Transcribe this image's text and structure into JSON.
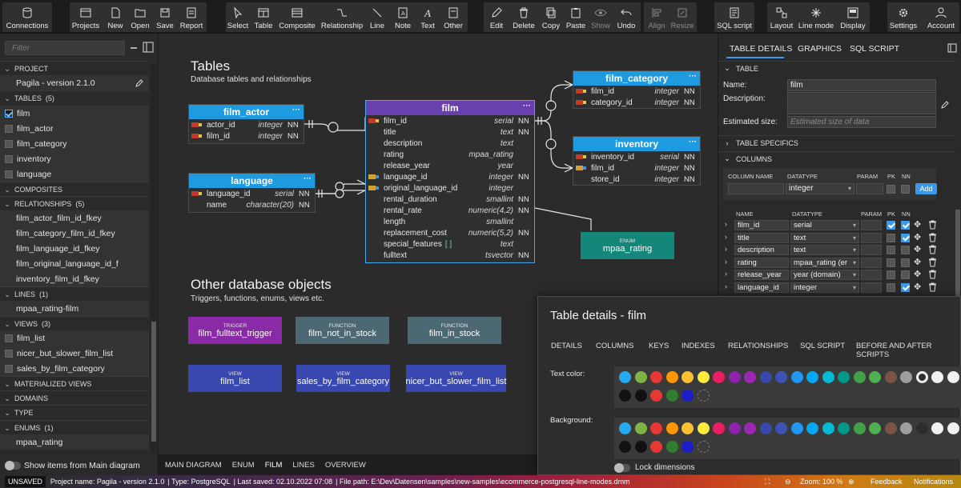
{
  "toolbar": {
    "connections": "Connections",
    "projects": "Projects",
    "new": "New",
    "open": "Open",
    "save": "Save",
    "report": "Report",
    "select": "Select",
    "table": "Table",
    "composite": "Composite",
    "relationship": "Relationship",
    "line": "Line",
    "note": "Note",
    "text": "Text",
    "other": "Other",
    "edit": "Edit",
    "delete": "Delete",
    "copy": "Copy",
    "paste": "Paste",
    "show": "Show",
    "undo": "Undo",
    "align": "Align",
    "resize": "Resize",
    "sql_script": "SQL script",
    "layout": "Layout",
    "line_mode": "Line mode",
    "display": "Display",
    "settings": "Settings",
    "account": "Account"
  },
  "left": {
    "filter_placeholder": "Filter",
    "project_header": "PROJECT",
    "project_name": "Pagila - version 2.1.0",
    "tables_header": "TABLES",
    "tables_count": "(5)",
    "tables": [
      "film",
      "film_actor",
      "film_category",
      "inventory",
      "language"
    ],
    "composites_header": "COMPOSITES",
    "relationships_header": "RELATIONSHIPS",
    "relationships_count": "(5)",
    "relationships": [
      "film_actor_film_id_fkey",
      "film_category_film_id_fkey",
      "film_language_id_fkey",
      "film_original_language_id_f",
      "inventory_film_id_fkey"
    ],
    "lines_header": "LINES",
    "lines_count": "(1)",
    "lines": [
      "mpaa_rating-film"
    ],
    "views_header": "VIEWS",
    "views_count": "(3)",
    "views": [
      "film_list",
      "nicer_but_slower_film_list",
      "sales_by_film_category"
    ],
    "mat_views_header": "MATERIALIZED VIEWS",
    "domains_header": "DOMAINS",
    "type_header": "TYPE",
    "enums_header": "ENUMS",
    "enums_count": "(1)",
    "enums": [
      "mpaa_rating"
    ],
    "show_items": "Show items from Main diagram"
  },
  "canvas": {
    "title": "Tables",
    "subtitle": "Database tables and relationships",
    "other_title": "Other database objects",
    "other_subtitle": "Triggers, functions, enums, views etc.",
    "film": {
      "name": "film",
      "cols": [
        [
          "pk",
          "film_id",
          "serial",
          "NN"
        ],
        [
          "",
          "title",
          "text",
          "NN"
        ],
        [
          "",
          "description",
          "text",
          ""
        ],
        [
          "",
          "rating",
          "mpaa_rating",
          ""
        ],
        [
          "",
          "release_year",
          "year",
          ""
        ],
        [
          "fk",
          "language_id",
          "integer",
          "NN"
        ],
        [
          "fk",
          "original_language_id",
          "integer",
          ""
        ],
        [
          "",
          "rental_duration",
          "smallint",
          "NN"
        ],
        [
          "",
          "rental_rate",
          "numeric(4,2)",
          "NN"
        ],
        [
          "",
          "length",
          "smallint",
          ""
        ],
        [
          "",
          "replacement_cost",
          "numeric(5,2)",
          "NN"
        ],
        [
          "",
          "special_features",
          "text",
          ""
        ],
        [
          "",
          "fulltext",
          "tsvector",
          "NN"
        ]
      ]
    },
    "film_actor": {
      "name": "film_actor",
      "cols": [
        [
          "pk",
          "actor_id",
          "integer",
          "NN"
        ],
        [
          "pk",
          "film_id",
          "integer",
          "NN"
        ]
      ]
    },
    "language": {
      "name": "language",
      "cols": [
        [
          "pk",
          "language_id",
          "serial",
          "NN"
        ],
        [
          "",
          "name",
          "character(20)",
          "NN"
        ]
      ]
    },
    "film_category": {
      "name": "film_category",
      "cols": [
        [
          "pk",
          "film_id",
          "integer",
          "NN"
        ],
        [
          "pk",
          "category_id",
          "integer",
          "NN"
        ]
      ]
    },
    "inventory": {
      "name": "inventory",
      "cols": [
        [
          "pk",
          "inventory_id",
          "serial",
          "NN"
        ],
        [
          "fk",
          "film_id",
          "integer",
          "NN"
        ],
        [
          "",
          "store_id",
          "integer",
          "NN"
        ]
      ]
    },
    "special_features_bracket": "[ ]",
    "enum_kind": "ENUM",
    "enum_name": "mpaa_rating",
    "trigger_kind": "TRIGGER",
    "trigger_name": "film_fulltext_trigger",
    "function_kind": "FUNCTION",
    "function1_name": "film_not_in_stock",
    "function2_name": "film_in_stock",
    "view_kind": "VIEW",
    "view1_name": "film_list",
    "view2_name": "sales_by_film_category",
    "view3_name": "nicer_but_slower_film_list"
  },
  "bottom_tabs": [
    "MAIN DIAGRAM",
    "ENUM",
    "FILM",
    "LINES",
    "OVERVIEW"
  ],
  "right": {
    "tabs": [
      "TABLE DETAILS",
      "GRAPHICS",
      "SQL SCRIPT"
    ],
    "table_header": "TABLE",
    "name_label": "Name:",
    "name_value": "film",
    "desc_label": "Description:",
    "est_label": "Estimated size:",
    "est_placeholder": "Estimated size of data",
    "specifics_header": "TABLE SPECIFICS",
    "columns_header": "COLUMNS",
    "new_col_headers": [
      "COLUMN NAME",
      "DATATYPE",
      "PARAM",
      "PK",
      "NN"
    ],
    "new_datatype": "integer",
    "add_label": "Add",
    "col_headers": [
      "NAME",
      "DATATYPE",
      "PARAM",
      "PK",
      "NN"
    ],
    "columns": [
      {
        "name": "film_id",
        "type": "serial",
        "pk": true,
        "nn": true
      },
      {
        "name": "title",
        "type": "text",
        "pk": false,
        "nn": true
      },
      {
        "name": "description",
        "type": "text",
        "pk": false,
        "nn": false
      },
      {
        "name": "rating",
        "type": "mpaa_rating (er",
        "pk": false,
        "nn": false
      },
      {
        "name": "release_year",
        "type": "year (domain)",
        "pk": false,
        "nn": false
      },
      {
        "name": "language_id",
        "type": "integer",
        "pk": false,
        "nn": true
      }
    ]
  },
  "dialog": {
    "title": "Table details - film",
    "tabs": [
      "DETAILS",
      "COLUMNS",
      "KEYS",
      "INDEXES",
      "RELATIONSHIPS",
      "SQL SCRIPT",
      "BEFORE AND AFTER SCRIPTS"
    ],
    "text_color_label": "Text color:",
    "background_label": "Background:",
    "lock_label": "Lock dimensions",
    "palette": [
      "#27a9f0",
      "#7cb342",
      "#e53935",
      "#ff9800",
      "#fbc02d",
      "#ffeb3b",
      "#e91e63",
      "#8e24aa",
      "#9c27b0",
      "#3949ab",
      "#3f51b5",
      "#2196f3",
      "#03a9f4",
      "#00bcd4",
      "#009688",
      "#43a047",
      "#4caf50",
      "#795548",
      "#9e9e9e"
    ]
  },
  "status": {
    "unsaved": "UNSAVED",
    "project": "Project name: Pagila - version 2.1.0",
    "type": "| Type: PostgreSQL",
    "saved": "| Last saved: 02.10.2022 07:08",
    "path": "| File path: E:\\Dev\\Datensen\\samples\\new-samples\\ecommerce-postgresql-line-modes.dmm",
    "zoom": "Zoom: 100 %",
    "feedback": "Feedback",
    "notifications": "Notifications"
  },
  "colors": {
    "header_blue": "#1e9be0",
    "film_purple": "#6a3fae",
    "enum_teal": "#14877a",
    "trigger_purple": "#8b2aa6",
    "function_gray": "#4c6873",
    "view_blue": "#3948b0"
  }
}
